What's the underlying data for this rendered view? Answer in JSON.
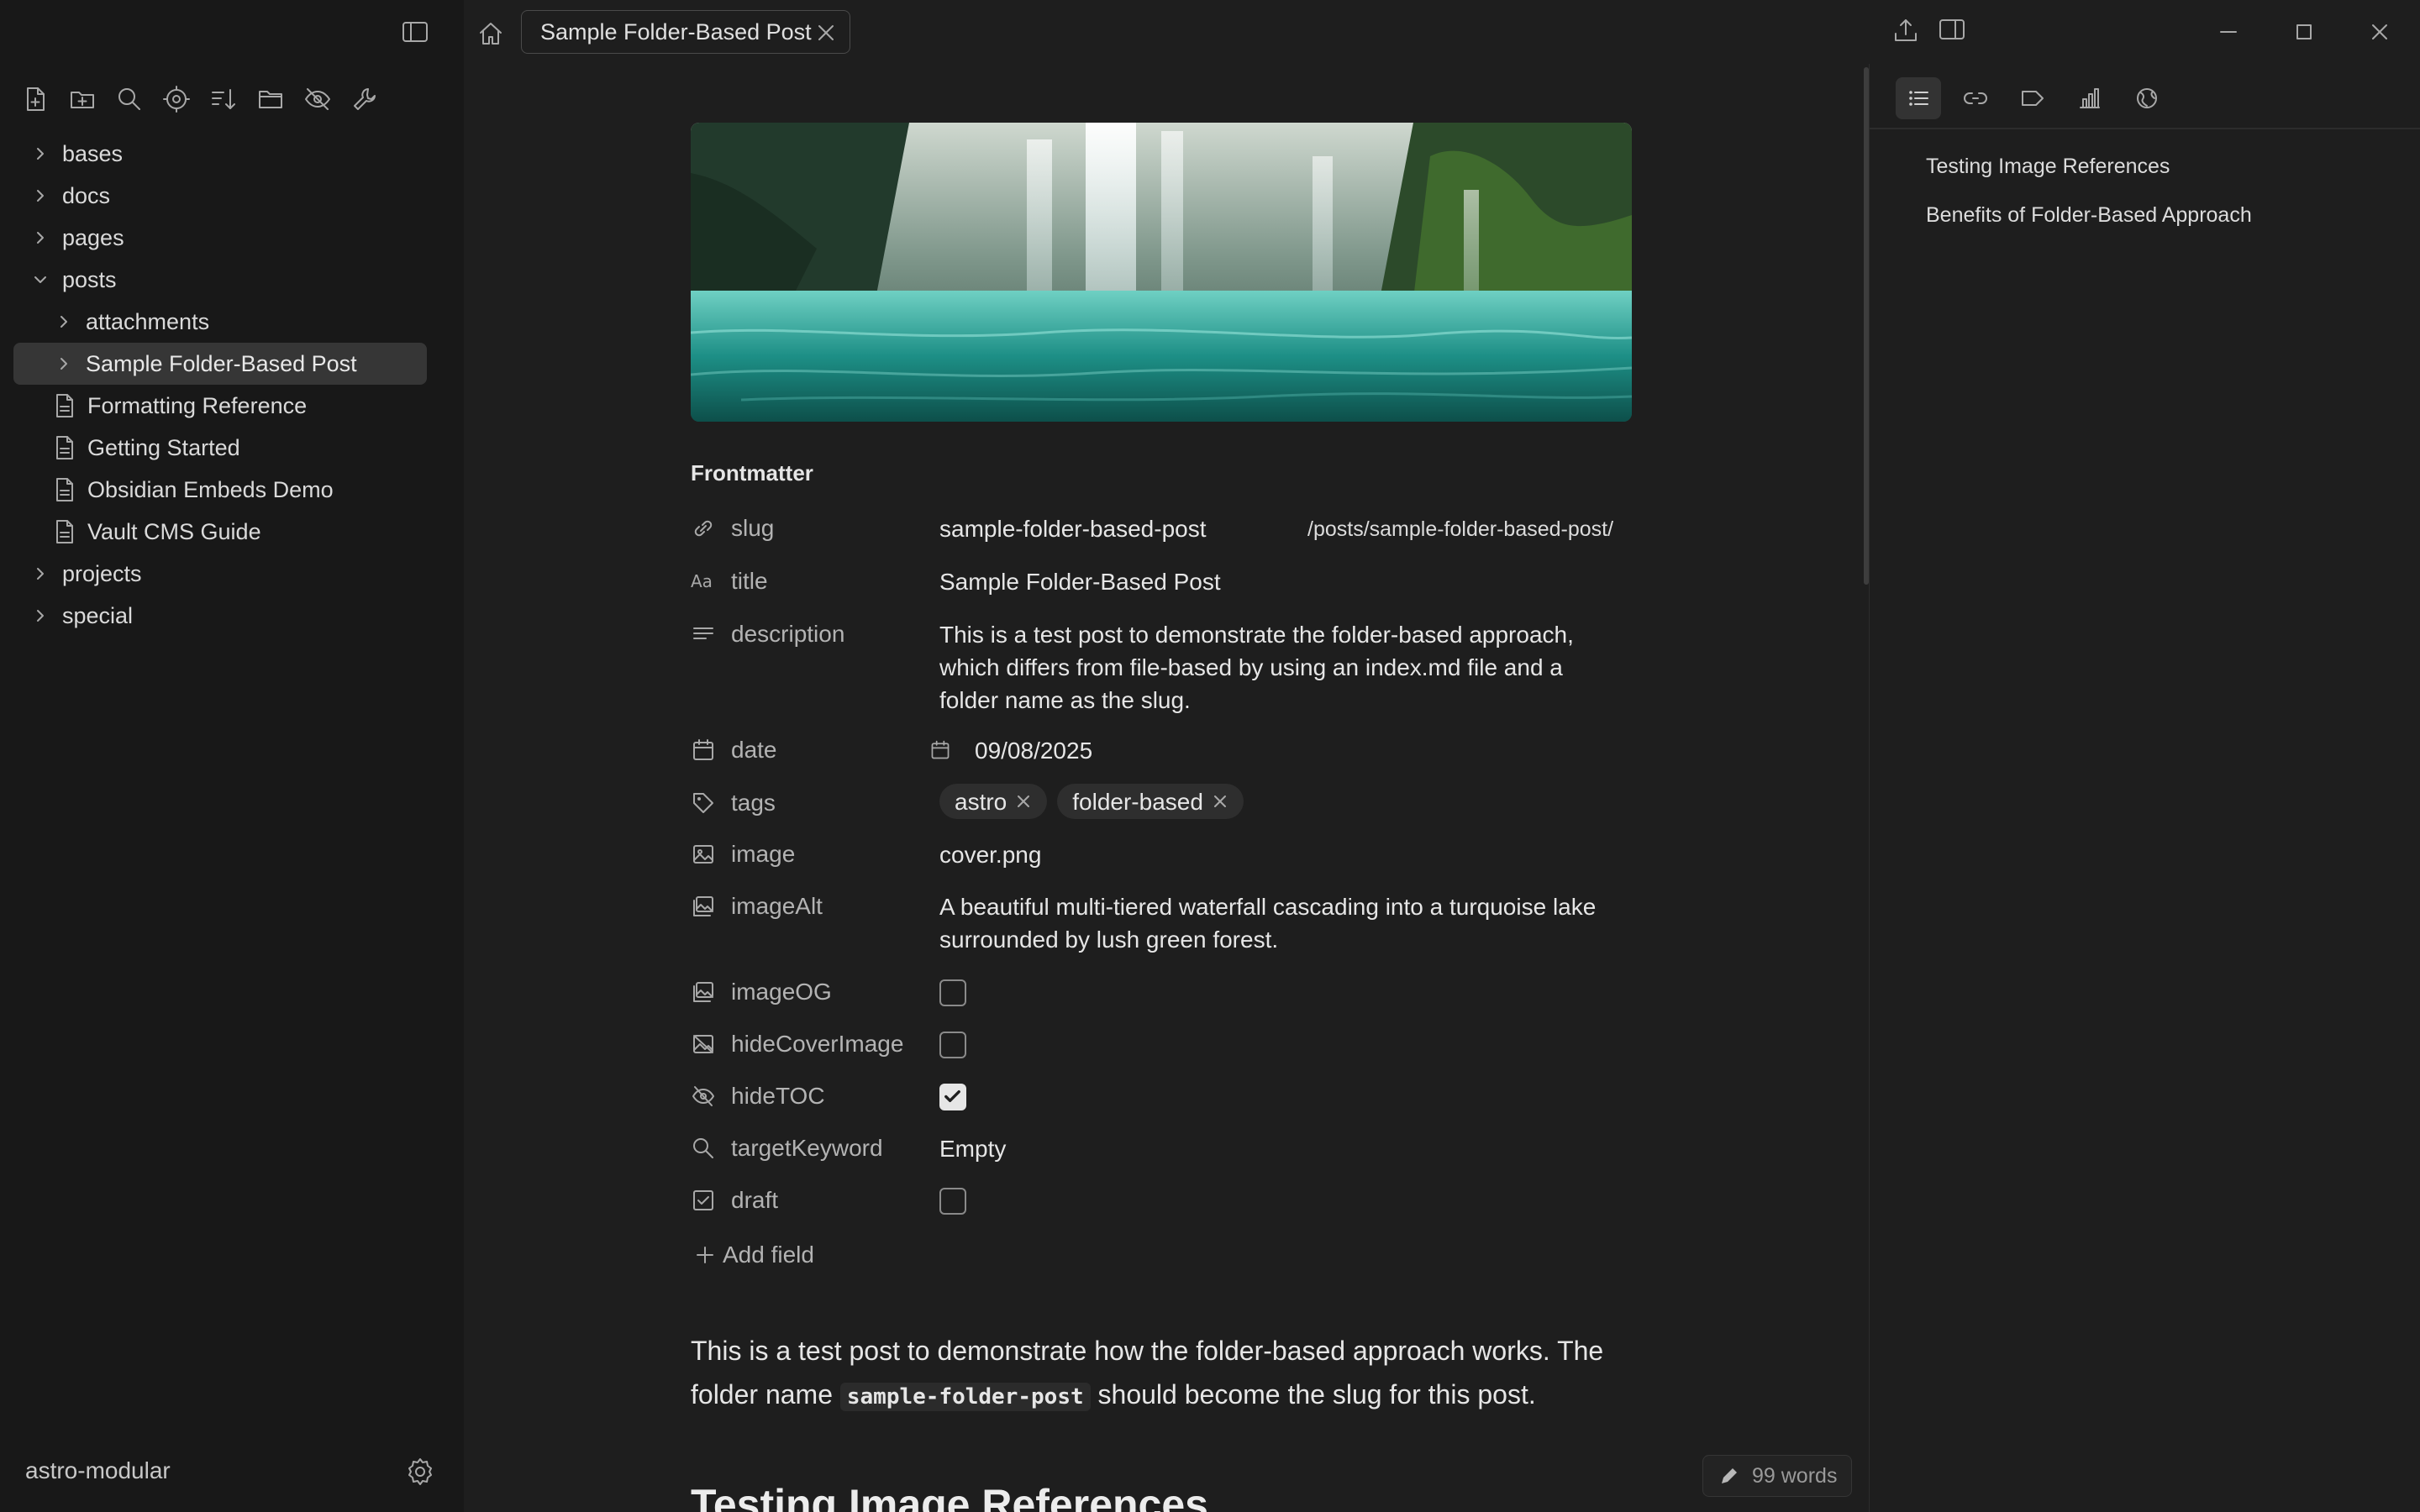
{
  "tab": {
    "title": "Sample Folder-Based Post"
  },
  "sidebar": {
    "vault_name": "astro-modular",
    "toolbar_icons": [
      "new-note-icon",
      "new-folder-icon",
      "search-icon",
      "target-icon",
      "sort-icon",
      "folder-icon",
      "hide-icon",
      "wrench-icon"
    ],
    "tree": [
      {
        "label": "bases",
        "type": "folder",
        "level": 0,
        "expanded": false
      },
      {
        "label": "docs",
        "type": "folder",
        "level": 0,
        "expanded": false
      },
      {
        "label": "pages",
        "type": "folder",
        "level": 0,
        "expanded": false
      },
      {
        "label": "posts",
        "type": "folder",
        "level": 0,
        "expanded": true
      },
      {
        "label": "attachments",
        "type": "folder",
        "level": 1,
        "expanded": false
      },
      {
        "label": "Sample Folder-Based Post",
        "type": "folder",
        "level": 1,
        "expanded": false,
        "active": true
      },
      {
        "label": "Formatting Reference",
        "type": "file",
        "level": 1
      },
      {
        "label": "Getting Started",
        "type": "file",
        "level": 1
      },
      {
        "label": "Obsidian Embeds Demo",
        "type": "file",
        "level": 1
      },
      {
        "label": "Vault CMS Guide",
        "type": "file",
        "level": 1
      },
      {
        "label": "projects",
        "type": "folder",
        "level": 0,
        "expanded": false
      },
      {
        "label": "special",
        "type": "folder",
        "level": 0,
        "expanded": false
      }
    ]
  },
  "frontmatter": {
    "heading": "Frontmatter",
    "slug": {
      "key": "slug",
      "value": "sample-folder-based-post",
      "url": "/posts/sample-folder-based-post/"
    },
    "title": {
      "key": "title",
      "value": "Sample Folder-Based Post"
    },
    "description": {
      "key": "description",
      "value": "This is a test post to demonstrate the folder-based approach, which differs from file-based by using an index.md file and a folder name as the slug."
    },
    "date": {
      "key": "date",
      "value": "09/08/2025"
    },
    "tags": {
      "key": "tags",
      "values": [
        "astro",
        "folder-based"
      ]
    },
    "image": {
      "key": "image",
      "value": "cover.png"
    },
    "imageAlt": {
      "key": "imageAlt",
      "value": "A beautiful multi-tiered waterfall cascading into a turquoise lake surrounded by lush green forest."
    },
    "imageOG": {
      "key": "imageOG",
      "checked": false
    },
    "hideCoverImage": {
      "key": "hideCoverImage",
      "checked": false
    },
    "hideTOC": {
      "key": "hideTOC",
      "checked": true
    },
    "targetKeyword": {
      "key": "targetKeyword",
      "value": "Empty"
    },
    "draft": {
      "key": "draft",
      "checked": false
    },
    "add_field": "Add field"
  },
  "body": {
    "para_before": "This is a test post to demonstrate how the folder-based approach works. The folder name ",
    "code": "sample-folder-post",
    "para_after": " should become the slug for this post.",
    "next_heading": "Testing Image References"
  },
  "status": {
    "word_count": "99 words"
  },
  "outline": {
    "items": [
      "Testing Image References",
      "Benefits of Folder-Based Approach"
    ]
  }
}
